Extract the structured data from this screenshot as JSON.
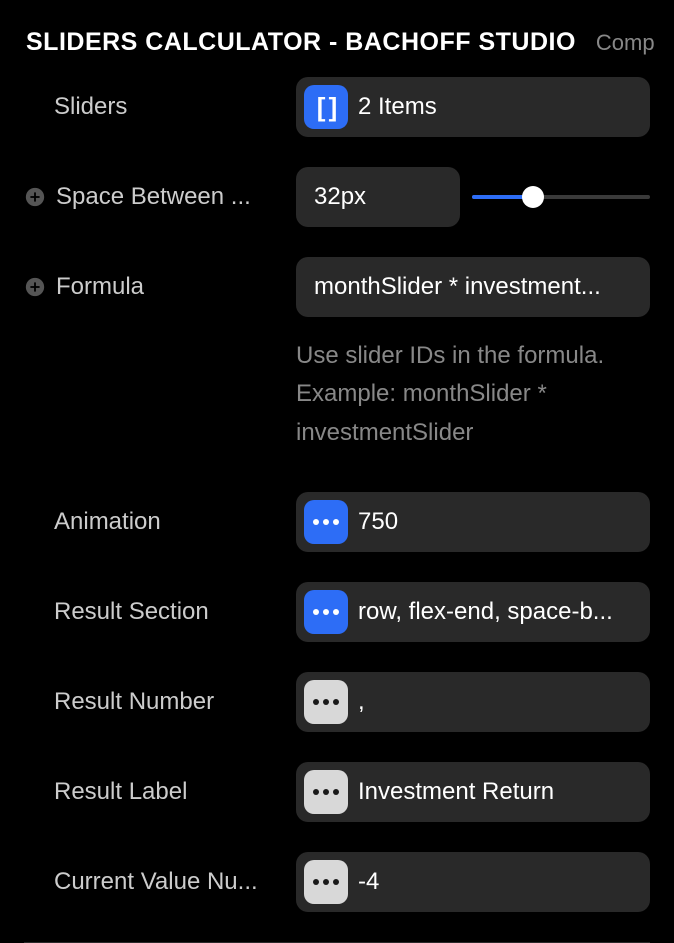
{
  "header": {
    "title": "SLIDERS CALCULATOR - BACHOFF STUDIO",
    "tab": "Componer"
  },
  "rows": {
    "sliders": {
      "label": "Sliders",
      "value": "2 Items"
    },
    "spaceBetween": {
      "label": "Space Between ...",
      "value": "32px"
    },
    "formula": {
      "label": "Formula",
      "value": "monthSlider * investment..."
    },
    "animation": {
      "label": "Animation",
      "value": "750"
    },
    "resultSection": {
      "label": "Result Section",
      "value": "row, flex-end, space-b..."
    },
    "resultNumber": {
      "label": "Result Number",
      "value": ","
    },
    "resultLabel": {
      "label": "Result Label",
      "value": "Investment Return"
    },
    "currentValueNu": {
      "label": "Current Value Nu...",
      "value": "-4"
    }
  },
  "helpText": "Use slider IDs in the formula. Example: monthSlider * investmentSlider"
}
